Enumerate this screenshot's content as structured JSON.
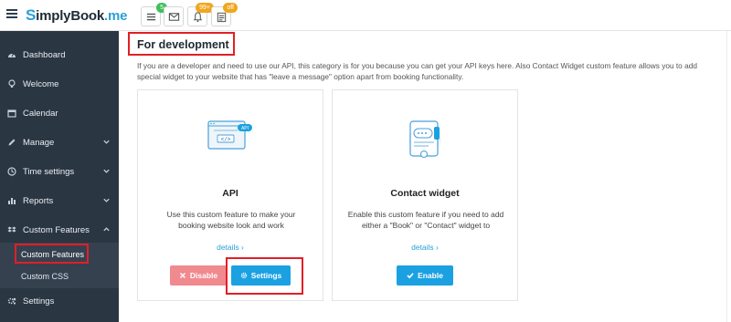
{
  "app": {
    "logo_s": "S",
    "logo_rest": "implyBook",
    "logo_suffix": ".me"
  },
  "topbar": {
    "icons": [
      {
        "name": "list-icon",
        "badge": "5",
        "badge_color": "#3fbf5a"
      },
      {
        "name": "mail-icon",
        "badge": ""
      },
      {
        "name": "bell-icon",
        "badge": "99+",
        "badge_color": "#f0a61e"
      },
      {
        "name": "calendar-doc-icon",
        "badge": "off",
        "badge_color": "#f0a61e"
      }
    ]
  },
  "sidebar": {
    "items": [
      {
        "label": "Dashboard",
        "icon": "dashboard-icon"
      },
      {
        "label": "Welcome",
        "icon": "lightbulb-icon"
      },
      {
        "label": "Calendar",
        "icon": "calendar-icon"
      },
      {
        "label": "Manage",
        "icon": "pencil-icon",
        "expandable": true
      },
      {
        "label": "Time settings",
        "icon": "clock-icon",
        "expandable": true
      },
      {
        "label": "Reports",
        "icon": "bar-chart-icon",
        "expandable": true
      },
      {
        "label": "Custom Features",
        "icon": "dropbox-icon",
        "expandable": true,
        "expanded": true
      },
      {
        "label": "Settings",
        "icon": "gears-icon"
      }
    ],
    "sub_items": [
      {
        "label": "Custom Features",
        "active": true
      },
      {
        "label": "Custom CSS"
      }
    ]
  },
  "main": {
    "heading": "For development",
    "description": "If you are a developer and need to use our API, this category is for you because you can get your API keys here. Also Contact Widget custom feature allows you to add special widget to your website that has \"leave a message\" option apart from booking functionality.",
    "cards": [
      {
        "title": "API",
        "illustration_label": "API",
        "text": "Use this custom feature to make your booking website look and work",
        "link": "details ›",
        "buttons": [
          {
            "label": "Disable",
            "icon": "x-icon"
          },
          {
            "label": "Settings",
            "icon": "gear-icon"
          }
        ]
      },
      {
        "title": "Contact widget",
        "text": "Enable this custom feature if you need to add either a \"Book\" or \"Contact\" widget to",
        "link": "details ›",
        "buttons": [
          {
            "label": "Enable",
            "icon": "check-icon"
          }
        ]
      }
    ]
  },
  "colors": {
    "sidebar_bg": "#2b3643",
    "accent_blue": "#1ba1e2",
    "disable_red": "#f08a8f",
    "highlight_red": "#e21f26",
    "link_blue": "#2a9fd6"
  }
}
